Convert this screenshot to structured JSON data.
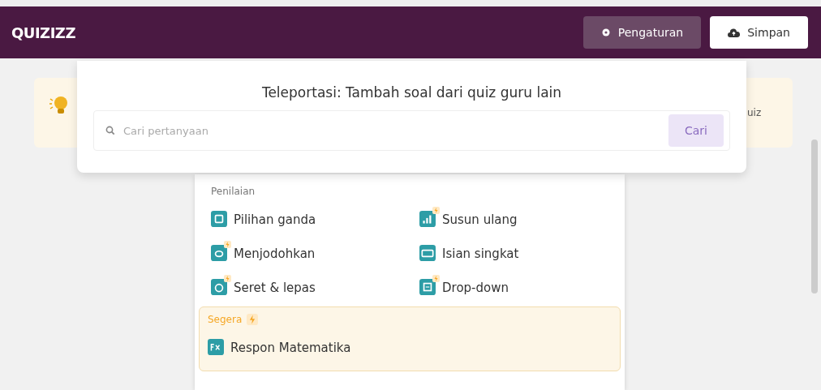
{
  "header": {
    "logo": "QUIZIZZ",
    "buttons": [
      {
        "label": "Pengaturan",
        "kind": "settings"
      },
      {
        "label": "Simpan",
        "kind": "save"
      }
    ]
  },
  "right_card": {
    "text": "uiz"
  },
  "teleport": {
    "title": "Teleportasi: Tambah soal dari quiz guru lain",
    "search": {
      "placeholder": "Cari pertanyaan"
    },
    "button": "Cari"
  },
  "menu": {
    "section": "Penilaian",
    "items": [
      {
        "label": "Pilihan ganda",
        "kind": "choice",
        "premium": false
      },
      {
        "label": "Susun ulang",
        "kind": "reorder",
        "premium": true
      },
      {
        "label": "Menjodohkan",
        "kind": "match",
        "premium": true
      },
      {
        "label": "Isian singkat",
        "kind": "fill",
        "premium": false
      },
      {
        "label": "Seret & lepas",
        "kind": "drag",
        "premium": true
      },
      {
        "label": "Drop-down",
        "kind": "dropdown",
        "premium": true
      }
    ],
    "soon": {
      "title": "Segera",
      "items": [
        {
          "label": "Respon Matematika",
          "kind": "math",
          "premium": false
        }
      ]
    }
  }
}
